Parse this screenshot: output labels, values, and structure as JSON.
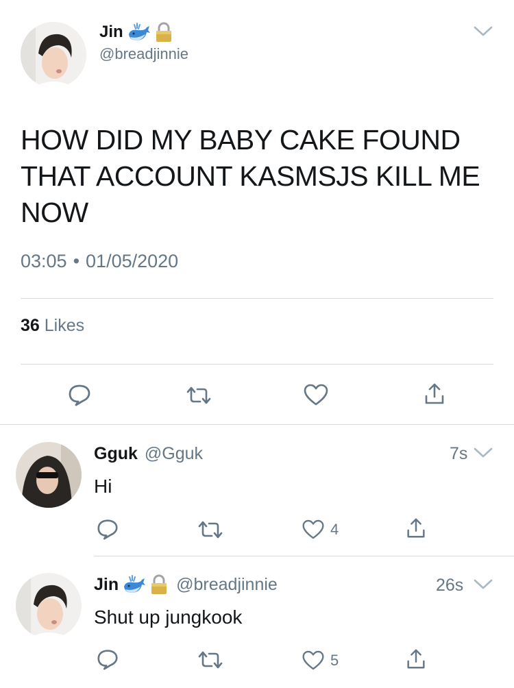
{
  "main_tweet": {
    "name": "Jin",
    "handle": "@breadjinnie",
    "text": "HOW DID MY BABY CAKE FOUND THAT ACCOUNT KASMSJS KILL ME NOW",
    "time": "03:05",
    "separator": "•",
    "date": "01/05/2020",
    "likes_count": "36",
    "likes_label": "Likes",
    "badges": [
      "whale-emoji",
      "lock-emoji"
    ]
  },
  "replies": [
    {
      "name": "Gguk",
      "handle": "@Gguk",
      "time": "7s",
      "text": "Hi",
      "like_count": "4"
    },
    {
      "name": "Jin",
      "handle": "@breadjinnie",
      "time": "26s",
      "text": "Shut up jungkook",
      "like_count": "5",
      "badges": [
        "whale-emoji",
        "lock-emoji"
      ]
    }
  ],
  "colors": {
    "text": "#14171a",
    "secondary": "#657786",
    "divider": "#d7dadd",
    "lock": "#d9b34a",
    "whale": "#3d88d6"
  }
}
